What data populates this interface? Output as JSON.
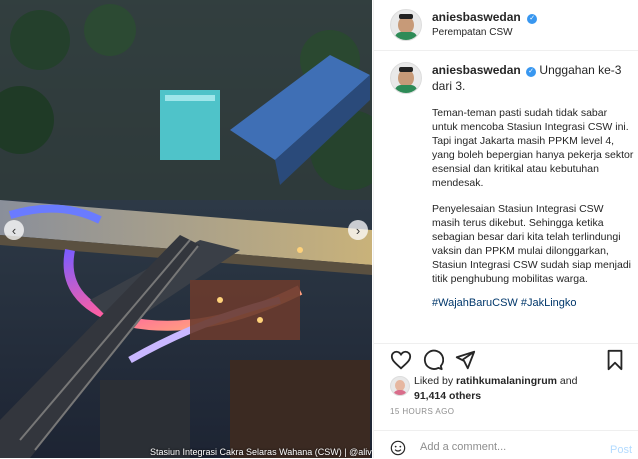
{
  "post": {
    "image_caption": "Stasiun Integrasi Cakra Selaras Wahana (CSW) | @alivikry",
    "nav_prev_symbol": "‹",
    "nav_next_symbol": "›"
  },
  "header": {
    "username": "aniesbaswedan",
    "verified_symbol": "✓",
    "location": "Perempatan CSW"
  },
  "comment": {
    "username": "aniesbaswedan",
    "verified_symbol": "✓",
    "lead": "Unggahan ke-3 dari 3.",
    "paragraph1": "Teman-teman pasti sudah tidak sabar untuk mencoba Stasiun Integrasi CSW ini. Tapi ingat Jakarta masih PPKM level 4, yang boleh bepergian hanya pekerja sektor esensial dan kritikal atau kebutuhan mendesak.",
    "paragraph2": "Penyelesaian Stasiun Integrasi CSW masih terus dikebut. Sehingga ketika sebagian besar dari kita telah terlindungi vaksin dan PPKM mulai dilonggarkan, Stasiun Integrasi CSW sudah siap menjadi titik penghubung mobilitas warga.",
    "hashtags": "#WajahBaruCSW #JakLingko"
  },
  "actions": {
    "icons": [
      "heart-icon",
      "comment-icon",
      "share-icon",
      "bookmark-icon"
    ]
  },
  "likes": {
    "prefix": "Liked by ",
    "user": "ratihkumalaningrum",
    "mid": " and",
    "count": "91,414 others"
  },
  "timestamp": "15 HOURS AGO",
  "add_comment": {
    "placeholder": "Add a comment...",
    "post_label": "Post"
  },
  "colors": {
    "link": "#00376b",
    "verified": "#3897f0",
    "post_disabled": "#b3dbff",
    "muted": "#8e8e8e"
  }
}
